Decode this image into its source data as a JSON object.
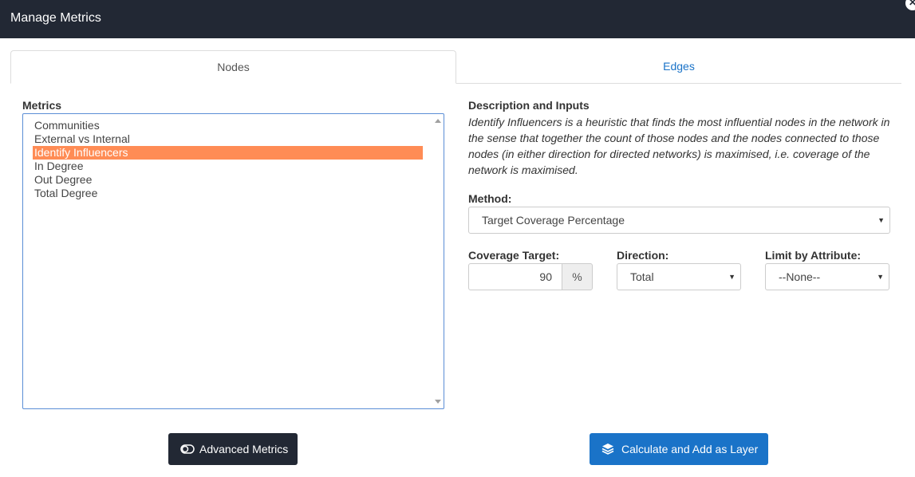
{
  "dialog": {
    "title": "Manage Metrics",
    "close_glyph": "✕"
  },
  "tabs": [
    {
      "label": "Nodes",
      "active": true
    },
    {
      "label": "Edges",
      "active": false
    }
  ],
  "metrics": {
    "label": "Metrics",
    "items": [
      "Communities",
      "External vs Internal",
      "Identify Influencers",
      "In Degree",
      "Out Degree",
      "Total Degree"
    ],
    "selected": "Identify Influencers"
  },
  "description": {
    "heading": "Description and Inputs",
    "text": "Identify Influencers is a heuristic that finds the most influential nodes in the network in the sense that together the count of those nodes and the nodes connected to those nodes (in either direction for directed networks) is maximised, i.e. coverage of the network is maximised."
  },
  "method": {
    "label": "Method:",
    "value": "Target Coverage Percentage"
  },
  "coverage_target": {
    "label": "Coverage Target:",
    "value": "90",
    "unit": "%"
  },
  "direction": {
    "label": "Direction:",
    "value": "Total"
  },
  "limit_by_attribute": {
    "label": "Limit by Attribute:",
    "value": "--None--"
  },
  "buttons": {
    "advanced_metrics": "Advanced Metrics",
    "calculate": "Calculate and Add as Layer"
  },
  "icons": {
    "toggle": "toggle-icon",
    "layers": "layers-icon",
    "close": "close-icon",
    "select_caret": "caret-down-icon"
  },
  "colors": {
    "header_bg": "#222834",
    "accent_blue": "#1a73c8",
    "selected_item": "#ff8c55",
    "dark_button": "#222834"
  }
}
